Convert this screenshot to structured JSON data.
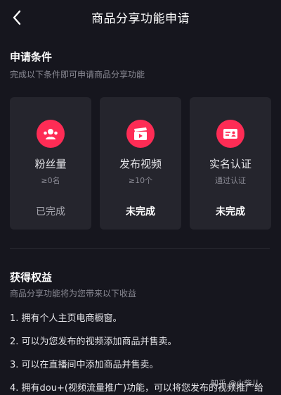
{
  "header": {
    "title": "商品分享功能申请"
  },
  "conditions": {
    "title": "申请条件",
    "subtitle": "完成以下条件即可申请商品分享功能",
    "cards": [
      {
        "icon": "fans-icon",
        "label": "粉丝量",
        "sub": "≥0名",
        "status": "已完成"
      },
      {
        "icon": "video-clapper-icon",
        "label": "发布视频",
        "sub": "≥10个",
        "status": "未完成"
      },
      {
        "icon": "id-card-icon",
        "label": "实名认证",
        "sub": "通过认证",
        "status": "未完成"
      }
    ]
  },
  "benefits": {
    "title": "获得权益",
    "subtitle": "商品分享功能将为您带来以下收益",
    "items": [
      "1. 拥有个人主页电商橱窗。",
      "2. 可以为您发布的视频添加商品并售卖。",
      "3. 可以在直播间中添加商品并售卖。",
      "4. 拥有dou+(视频流量推广)功能，可以将您发布的视频推广给"
    ]
  },
  "watermark": "知乎 @火柴儿",
  "colors": {
    "background": "#16161e",
    "card": "#25252d",
    "accent": "#fe2c55"
  }
}
